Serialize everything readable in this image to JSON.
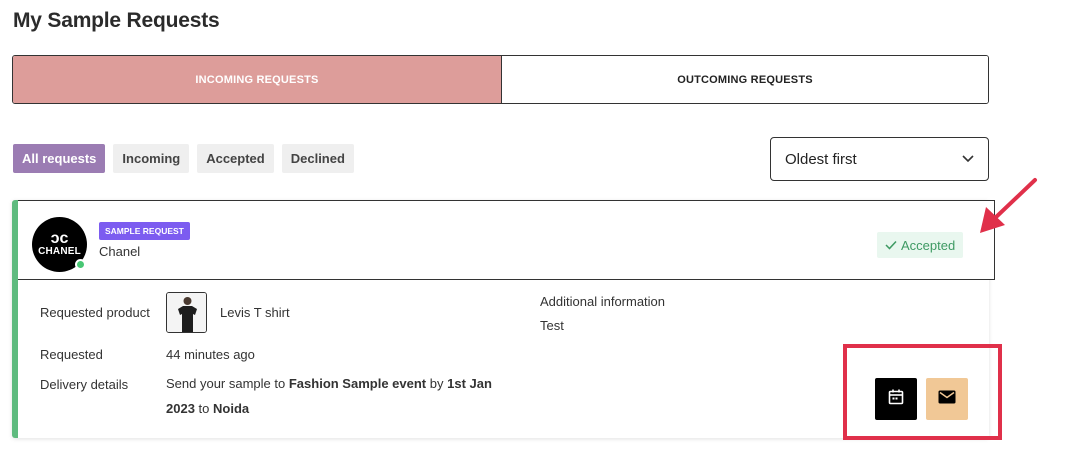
{
  "page": {
    "title": "My Sample Requests"
  },
  "tabs": [
    {
      "label": "INCOMING REQUESTS",
      "active": true
    },
    {
      "label": "OUTCOMING REQUESTS",
      "active": false
    }
  ],
  "filters": [
    {
      "label": "All requests",
      "active": true
    },
    {
      "label": "Incoming",
      "active": false
    },
    {
      "label": "Accepted",
      "active": false
    },
    {
      "label": "Declined",
      "active": false
    }
  ],
  "sort": {
    "selected": "Oldest first"
  },
  "card": {
    "avatar_logo": "ↄc",
    "avatar_text": "CHANEL",
    "badge": "SAMPLE REQUEST",
    "brand": "Chanel",
    "status": "Accepted",
    "status_icon": "check-icon",
    "requested_product_label": "Requested product",
    "product_name": "Levis T shirt",
    "additional_info_label": "Additional information",
    "additional_info_value": "Test",
    "requested_label": "Requested",
    "requested_value": "44 minutes ago",
    "delivery_label": "Delivery details",
    "delivery": {
      "prefix": "Send your sample to",
      "event": "Fashion Sample event",
      "by_text": "by",
      "date": "1st Jan 2023",
      "to_text": "to",
      "location": "Noida"
    },
    "actions": [
      {
        "icon": "calendar-icon",
        "color": "#000000"
      },
      {
        "icon": "mail-icon",
        "color": "#f1c896"
      }
    ]
  },
  "colors": {
    "active_tab": "#dd9d9a",
    "active_filter": "#9b7cb3",
    "badge": "#7c5cf0",
    "accent_border": "#5fbb7f",
    "status_bg": "#e9f7ef",
    "annotation": "#e0304a"
  }
}
